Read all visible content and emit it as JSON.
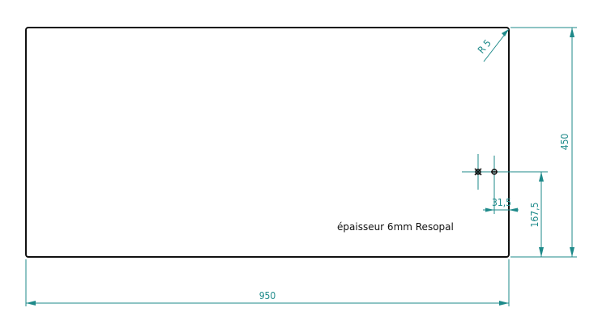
{
  "drawing": {
    "colors": {
      "outline": "#111111",
      "dimension": "#1e8a8a",
      "background": "#ffffff"
    },
    "dimensions": {
      "width": "950",
      "height": "450",
      "hole_offset_x": "31,5",
      "hole_offset_y": "167,5",
      "corner_radius": "R 5"
    },
    "note": "épaisseur 6mm Resopal"
  }
}
